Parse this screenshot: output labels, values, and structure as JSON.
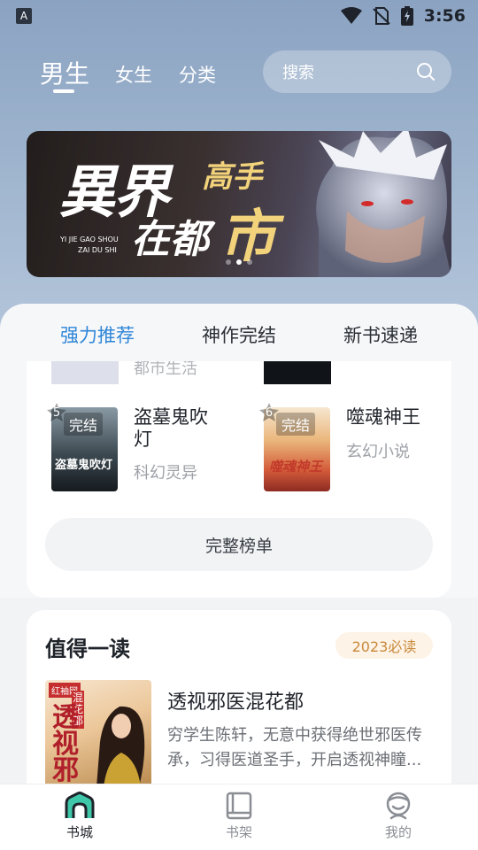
{
  "status_bar": {
    "app_badge": "A",
    "time": "3:56"
  },
  "top_nav": {
    "tabs": [
      {
        "label": "男生",
        "active": true
      },
      {
        "label": "女生",
        "active": false
      },
      {
        "label": "分类",
        "active": false
      }
    ],
    "search_placeholder": "搜索"
  },
  "banner": {
    "line1": "異界",
    "line2": "高手",
    "line3": "在都",
    "line4": "市",
    "pinyin1": "YI JIE GAO SHOU",
    "pinyin2": "ZAI DU SHI",
    "dot_count": 3,
    "active_dot": 1
  },
  "ranking": {
    "tabs": [
      {
        "label": "强力推荐",
        "active": true
      },
      {
        "label": "神作完结",
        "active": false
      },
      {
        "label": "新书速递",
        "active": false
      }
    ],
    "partial_category": "都市生活",
    "books": [
      {
        "rank": "5",
        "title": "盗墓鬼吹灯",
        "category": "科幻灵异",
        "cover_tag": "完结",
        "cover_title": "盗墓鬼吹灯",
        "accent": "#5a7a8a"
      },
      {
        "rank": "6",
        "title": "噬魂神王",
        "category": "玄幻小说",
        "cover_tag": "完结",
        "cover_title": "噬魂神王",
        "accent": "#c23a2a"
      }
    ],
    "full_list_label": "完整榜单"
  },
  "worth_reading": {
    "title": "值得一读",
    "badge": "2023必读",
    "book": {
      "title": "透视邪医混花都",
      "description": "穷学生陈轩，无意中获得绝世邪医传承，习得医道圣手，开启透视神瞳...",
      "cover_title": "透视邪医",
      "cover_side": "混花都",
      "cover_logo": "红袖网"
    }
  },
  "bottom_nav": {
    "items": [
      {
        "label": "书城",
        "active": true
      },
      {
        "label": "书架",
        "active": false
      },
      {
        "label": "我的",
        "active": false
      }
    ]
  },
  "colors": {
    "accent_blue": "#2f86d8",
    "badge_text": "#c98a3d",
    "badge_bg": "#fdf3e6"
  }
}
